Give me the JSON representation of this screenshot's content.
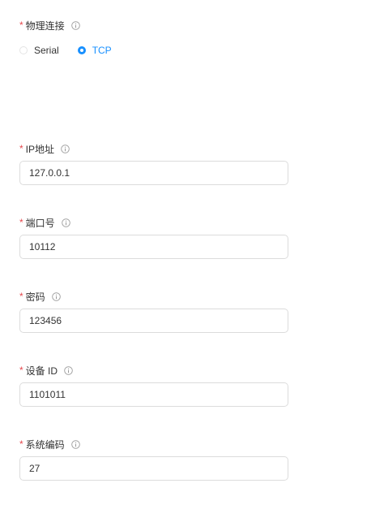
{
  "connection": {
    "required_mark": "*",
    "label": "物理连接",
    "options": [
      {
        "label": "Serial",
        "checked": false
      },
      {
        "label": "TCP",
        "checked": true
      }
    ]
  },
  "fields": {
    "ip": {
      "required_mark": "*",
      "label": "IP地址",
      "value": "127.0.0.1"
    },
    "port": {
      "required_mark": "*",
      "label": "端口号",
      "value": "10112"
    },
    "password": {
      "required_mark": "*",
      "label": "密码",
      "value": "123456"
    },
    "device_id": {
      "required_mark": "*",
      "label": "设备 ID",
      "value": "1101011"
    },
    "system_code": {
      "required_mark": "*",
      "label": "系统编码",
      "value": "27"
    }
  },
  "icons": {
    "info": "info-circle-icon"
  },
  "colors": {
    "accent": "#1890ff",
    "required": "#e5484d",
    "border": "#dcdcdc",
    "text": "#333333"
  }
}
